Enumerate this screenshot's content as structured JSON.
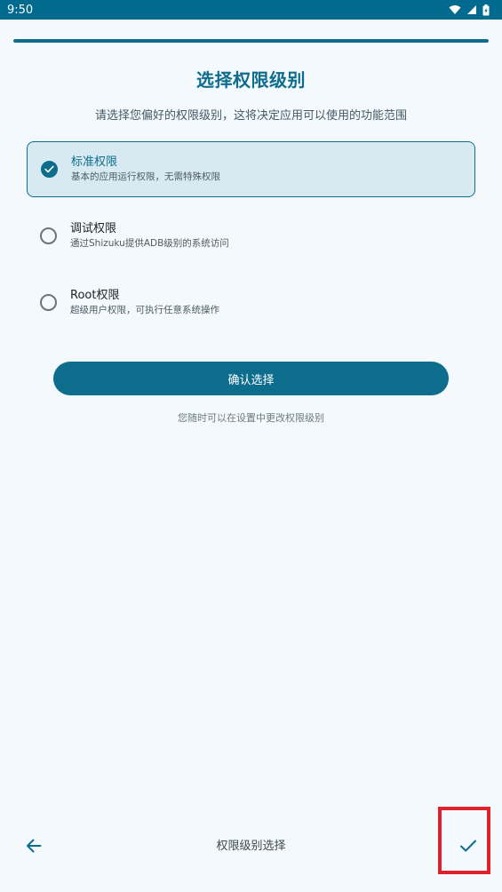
{
  "status_bar": {
    "time": "9:50",
    "icons": [
      "wifi-icon",
      "signal-icon",
      "battery-icon"
    ]
  },
  "progress": {
    "fraction": 1.0
  },
  "header": {
    "title": "选择权限级别",
    "subtitle": "请选择您偏好的权限级别，这将决定应用可以使用的功能范围"
  },
  "options": [
    {
      "title": "标准权限",
      "description": "基本的应用运行权限，无需特殊权限",
      "selected": true
    },
    {
      "title": "调试权限",
      "description": "通过Shizuku提供ADB级别的系统访问",
      "selected": false
    },
    {
      "title": "Root权限",
      "description": "超级用户权限，可执行任意系统操作",
      "selected": false
    }
  ],
  "confirm_button": {
    "label": "确认选择"
  },
  "hint": "您随时可以在设置中更改权限级别",
  "bottom_bar": {
    "title": "权限级别选择",
    "back_icon": "arrow-left-icon",
    "done_icon": "check-icon"
  },
  "colors": {
    "accent": "#0e6d8d",
    "status_bar": "#006b8f",
    "background": "#f3f9fd",
    "selected_background": "#d7eaf2",
    "highlight": "#e0202a"
  }
}
